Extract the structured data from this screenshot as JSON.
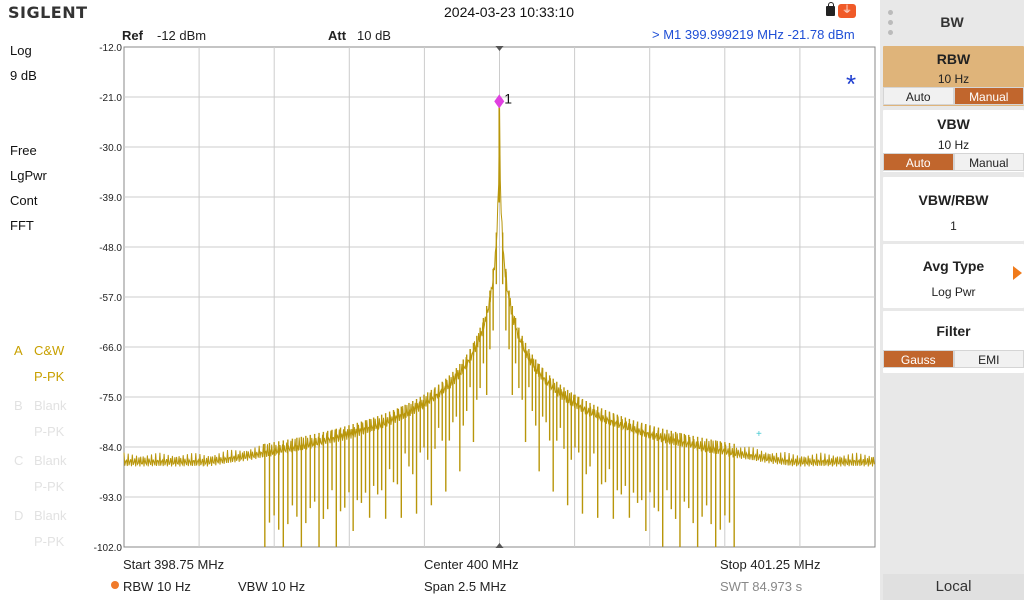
{
  "header": {
    "brand": "SIGLENT",
    "datetime": "2024-03-23 10:33:10",
    "icons": [
      "lock-icon",
      "usb-icon"
    ]
  },
  "left_panel": {
    "scale_type": "Log",
    "scale_div": "9 dB",
    "trig": "Free",
    "detector": "LgPwr",
    "sweep": "Cont",
    "mode": "FFT",
    "traces": [
      {
        "letter": "A",
        "line1": "C&W",
        "line2": "P-PK",
        "active": true
      },
      {
        "letter": "B",
        "line1": "Blank",
        "line2": "P-PK",
        "active": false
      },
      {
        "letter": "C",
        "line1": "Blank",
        "line2": "P-PK",
        "active": false
      },
      {
        "letter": "D",
        "line1": "Blank",
        "line2": "P-PK",
        "active": false
      }
    ]
  },
  "graph_header": {
    "ref_label": "Ref",
    "ref_value": "-12 dBm",
    "att_label": "Att",
    "att_value": "10 dB",
    "marker_readout": ">  M1    399.999219 MHz    -21.78 dBm"
  },
  "plot": {
    "y_ticks": [
      "-12.0",
      "-21.0",
      "-30.0",
      "-39.0",
      "-48.0",
      "-57.0",
      "-66.0",
      "-75.0",
      "-84.0",
      "-93.0",
      "-102.0"
    ],
    "y_top_dbm": -12,
    "y_bottom_dbm": -102,
    "x_start_mhz": 398.75,
    "x_stop_mhz": 401.25,
    "marker_label": "1",
    "marker_freq_mhz": 399.999219,
    "marker_level_dbm": -21.78,
    "star_symbol": "*",
    "trace_color": "#b8960a",
    "marker_color": "#e040e0",
    "grid_color": "#cccccc"
  },
  "bottom": {
    "start": "Start  398.75 MHz",
    "center": "Center  400 MHz",
    "stop": "Stop  401.25 MHz",
    "rbw": "RBW  10 Hz",
    "vbw": "VBW  10 Hz",
    "span": "Span   2.5 MHz",
    "swt": "SWT  84.973 s"
  },
  "menu": {
    "title": "BW",
    "rbw": {
      "title": "RBW",
      "value": "10 Hz",
      "opt_auto": "Auto",
      "opt_manual": "Manual"
    },
    "vbw": {
      "title": "VBW",
      "value": "10 Hz",
      "opt_auto": "Auto",
      "opt_manual": "Manual"
    },
    "vbw_rbw": {
      "title": "VBW/RBW",
      "value": "1"
    },
    "avg_type": {
      "title": "Avg Type",
      "value": "Log Pwr"
    },
    "filter": {
      "title": "Filter",
      "opt_gauss": "Gauss",
      "opt_emi": "EMI"
    },
    "local": "Local",
    "accent_color": "#c1662d",
    "highlight_color": "#dfb47a"
  }
}
